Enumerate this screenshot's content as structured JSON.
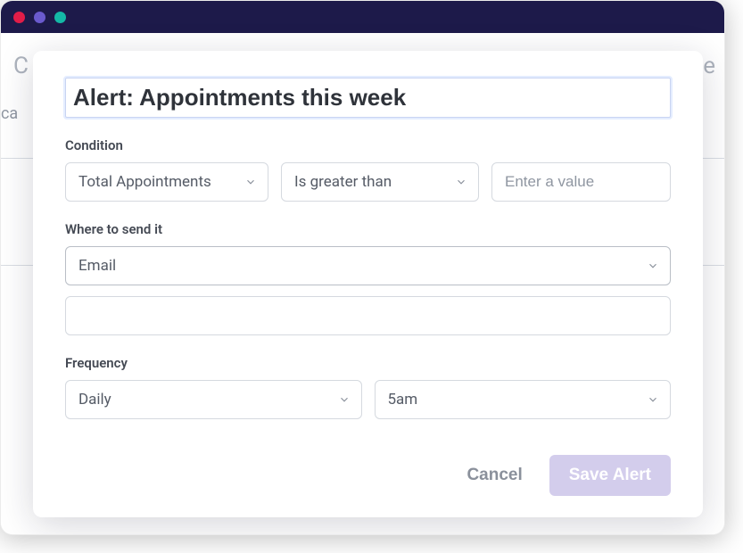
{
  "background": {
    "left_text": "C",
    "right_text": "ne",
    "sub_text": "ca"
  },
  "modal": {
    "title_value": "Alert: Appointments this week",
    "condition": {
      "label": "Condition",
      "metric_selected": "Total Appointments",
      "operator_selected": "Is greater than",
      "value_placeholder": "Enter a value",
      "value": ""
    },
    "destination": {
      "label": "Where to send it",
      "method_selected": "Email",
      "target_value": ""
    },
    "frequency": {
      "label": "Frequency",
      "cadence_selected": "Daily",
      "time_selected": "5am"
    },
    "footer": {
      "cancel_label": "Cancel",
      "save_label": "Save Alert"
    }
  }
}
